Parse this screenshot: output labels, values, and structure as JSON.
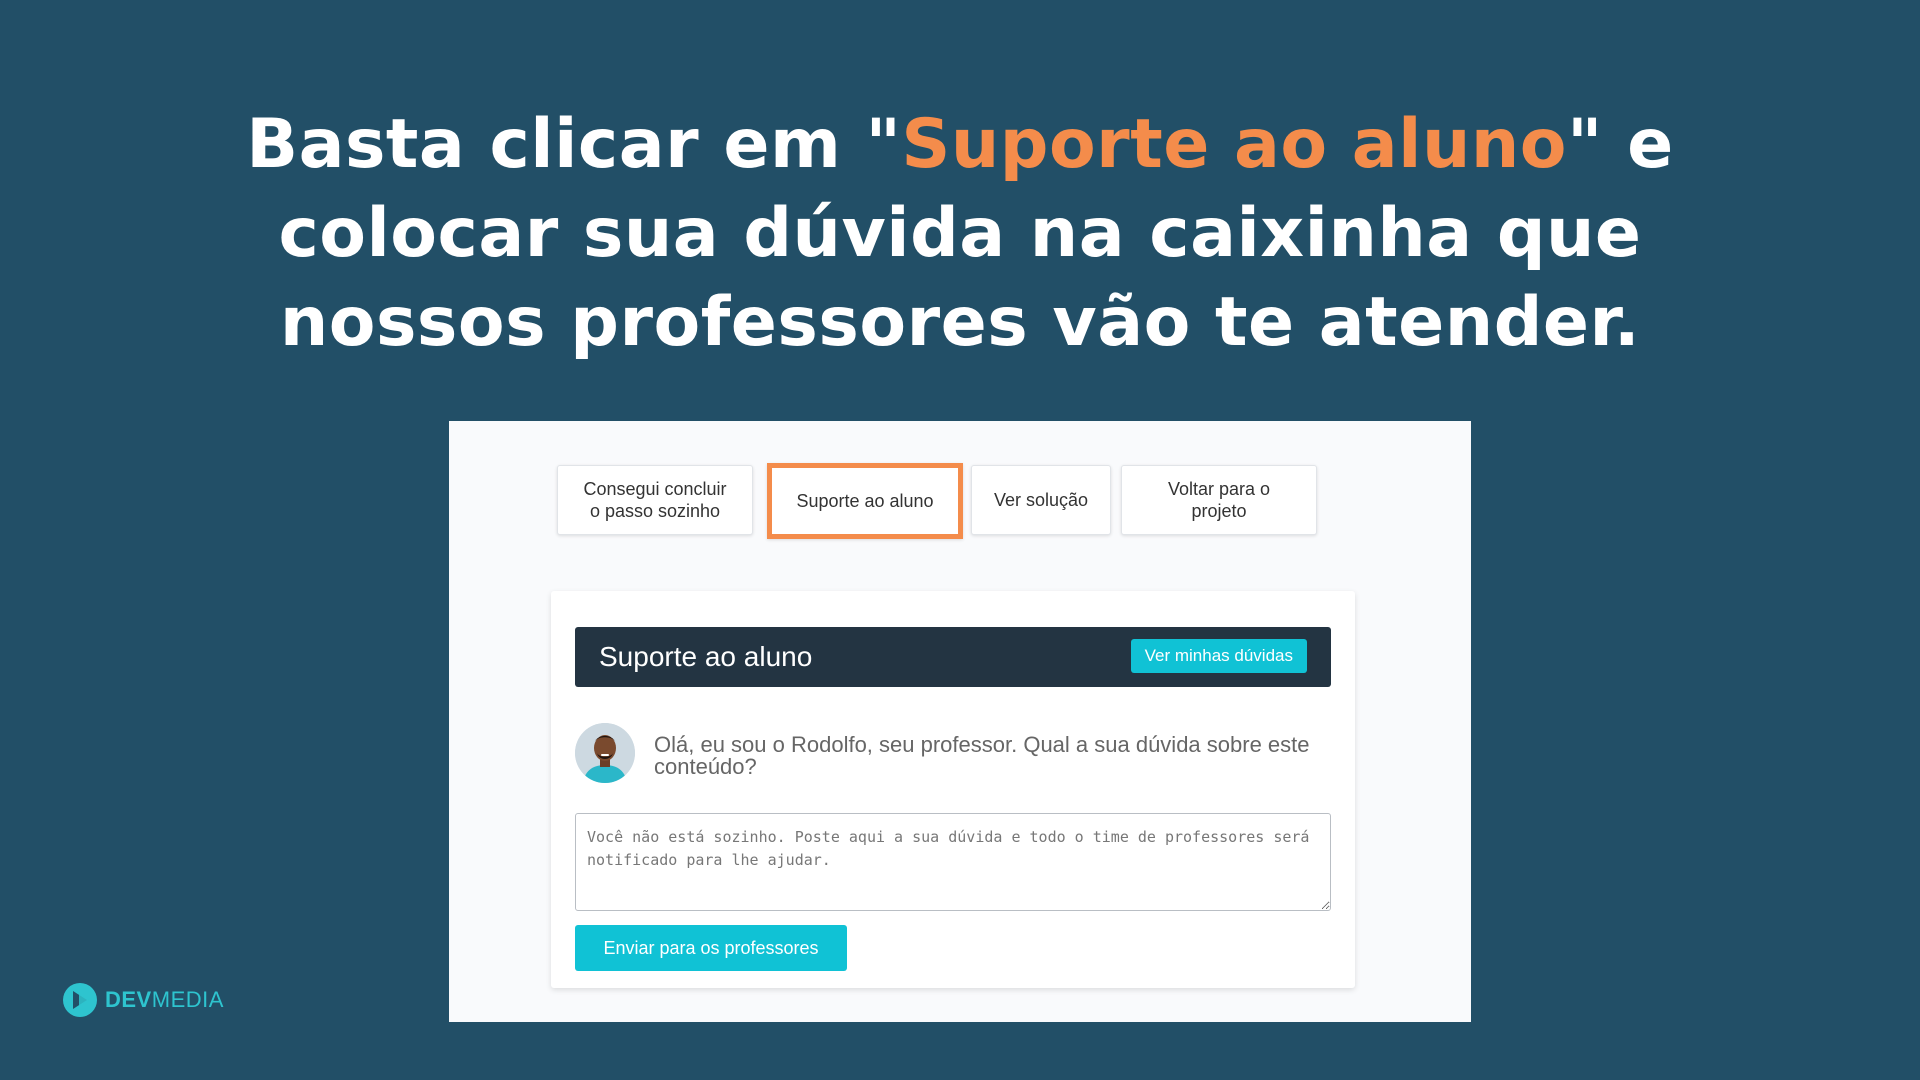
{
  "headline": {
    "before": "Basta clicar em \"",
    "highlight": "Suporte ao aluno",
    "after": "\" e colocar sua dúvida na caixinha que nossos professores vão te atender."
  },
  "colors": {
    "background": "#224f67",
    "highlight": "#f48c4b",
    "accent": "#10c2d5",
    "header_dark": "#233442"
  },
  "tabs": [
    {
      "label": "Consegui concluir o passo sozinho",
      "selected": false
    },
    {
      "label": "Suporte ao aluno",
      "selected": true
    },
    {
      "label": "Ver solução",
      "selected": false
    },
    {
      "label": "Voltar para o projeto",
      "selected": false
    }
  ],
  "support": {
    "title": "Suporte ao aluno",
    "my_questions_button": "Ver minhas dúvidas",
    "avatar_icon": "teacher-avatar",
    "professor_message": "Olá, eu sou o Rodolfo, seu professor. Qual a sua dúvida sobre este conteúdo?",
    "question_placeholder": "Você não está sozinho. Poste aqui a sua dúvida e todo o time de professores será notificado para lhe ajudar.",
    "send_button": "Enviar para os professores"
  },
  "logo": {
    "part1": "DEV",
    "part2": "MEDIA",
    "icon": "devmedia-logo-icon"
  }
}
